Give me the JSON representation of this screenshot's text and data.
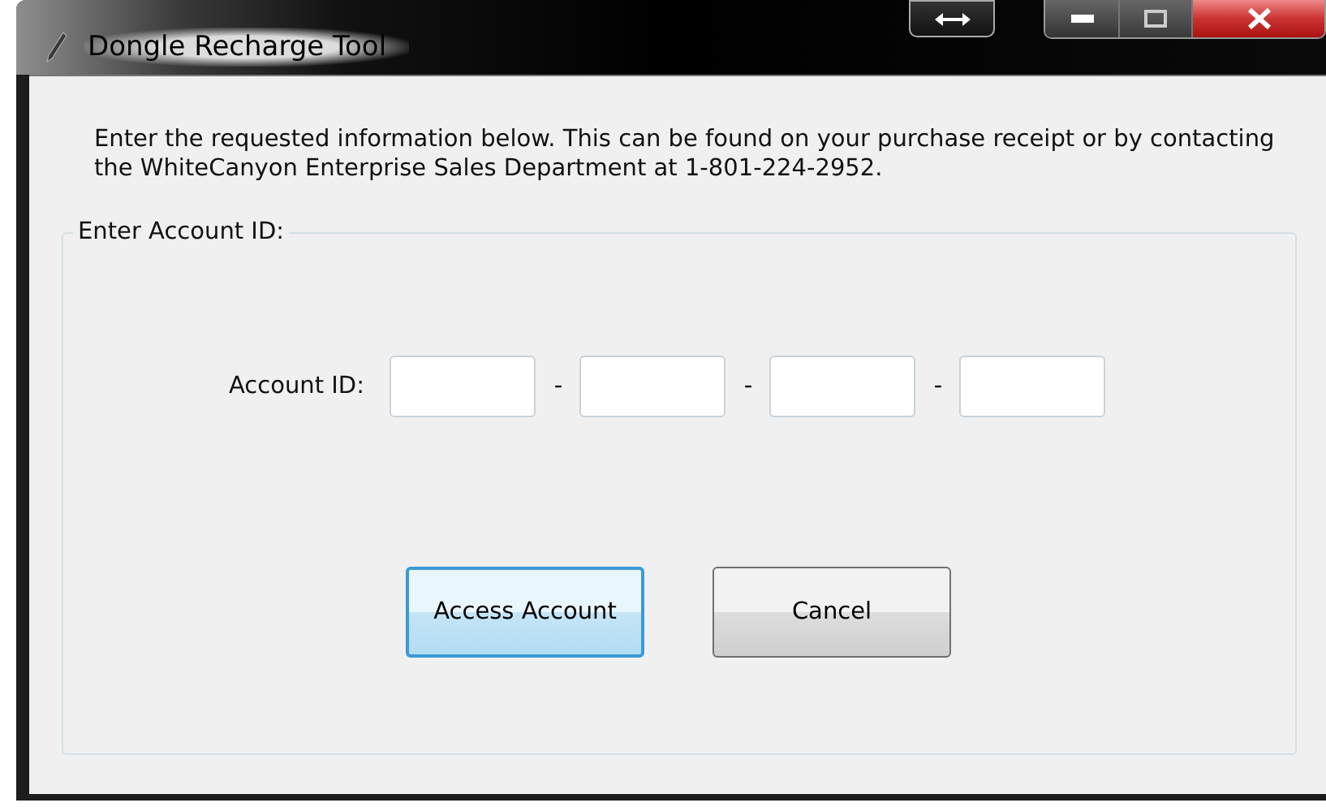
{
  "window": {
    "title": "Dongle Recharge Tool"
  },
  "instructions": "Enter the requested information below.  This can be found on your purchase receipt or by contacting the WhiteCanyon Enterprise Sales Department at 1-801-224-2952.",
  "group": {
    "legend": "Enter Account ID:",
    "label": "Account ID:",
    "separators": [
      "-",
      "-",
      "-"
    ]
  },
  "buttons": [
    {
      "label": "Access Account",
      "default": true
    },
    {
      "label": "Cancel",
      "default": false
    }
  ]
}
